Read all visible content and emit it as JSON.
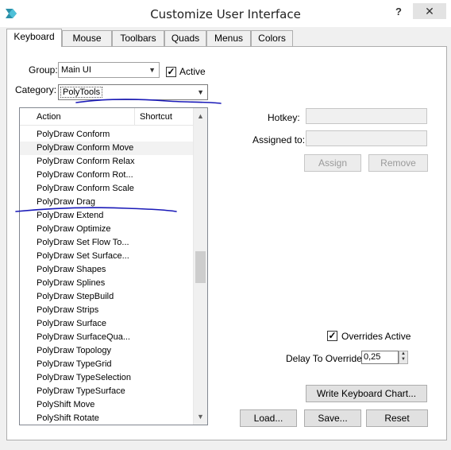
{
  "window": {
    "title": "Customize User Interface",
    "help_glyph": "?",
    "close_glyph": "✕"
  },
  "tabs": [
    {
      "label": "Keyboard",
      "active": true
    },
    {
      "label": "Mouse",
      "active": false
    },
    {
      "label": "Toolbars",
      "active": false
    },
    {
      "label": "Quads",
      "active": false
    },
    {
      "label": "Menus",
      "active": false
    },
    {
      "label": "Colors",
      "active": false
    }
  ],
  "form": {
    "group_label": "Group:",
    "group_value": "Main UI",
    "active_label": "Active",
    "active_checked": true,
    "category_label": "Category:",
    "category_value": "PolyTools"
  },
  "action_list": {
    "columns": [
      "Action",
      "Shortcut"
    ],
    "rows": [
      "PolyDraw Conform",
      "PolyDraw Conform Move",
      "PolyDraw Conform Relax",
      "PolyDraw Conform Rot...",
      "PolyDraw Conform Scale",
      "PolyDraw Drag",
      "PolyDraw Extend",
      "PolyDraw Optimize",
      "PolyDraw Set Flow To...",
      "PolyDraw Set Surface...",
      "PolyDraw Shapes",
      "PolyDraw Splines",
      "PolyDraw StepBuild",
      "PolyDraw Strips",
      "PolyDraw Surface",
      "PolyDraw SurfaceQua...",
      "PolyDraw Topology",
      "PolyDraw TypeGrid",
      "PolyDraw TypeSelection",
      "PolyDraw TypeSurface",
      "PolyShift Move",
      "PolyShift Rotate"
    ],
    "selected_row": "PolyDraw Conform Move"
  },
  "hotkey": {
    "hotkey_label": "Hotkey:",
    "assigned_label": "Assigned to:",
    "assign_button": "Assign",
    "remove_button": "Remove"
  },
  "overrides": {
    "overrides_label": "Overrides Active",
    "overrides_checked": true,
    "delay_label": "Delay To Override:",
    "delay_value": "0,25"
  },
  "buttons": {
    "write_chart": "Write Keyboard Chart...",
    "load": "Load...",
    "save": "Save...",
    "reset": "Reset"
  },
  "colors": {
    "annotation_ink": "#1a1ab8"
  }
}
